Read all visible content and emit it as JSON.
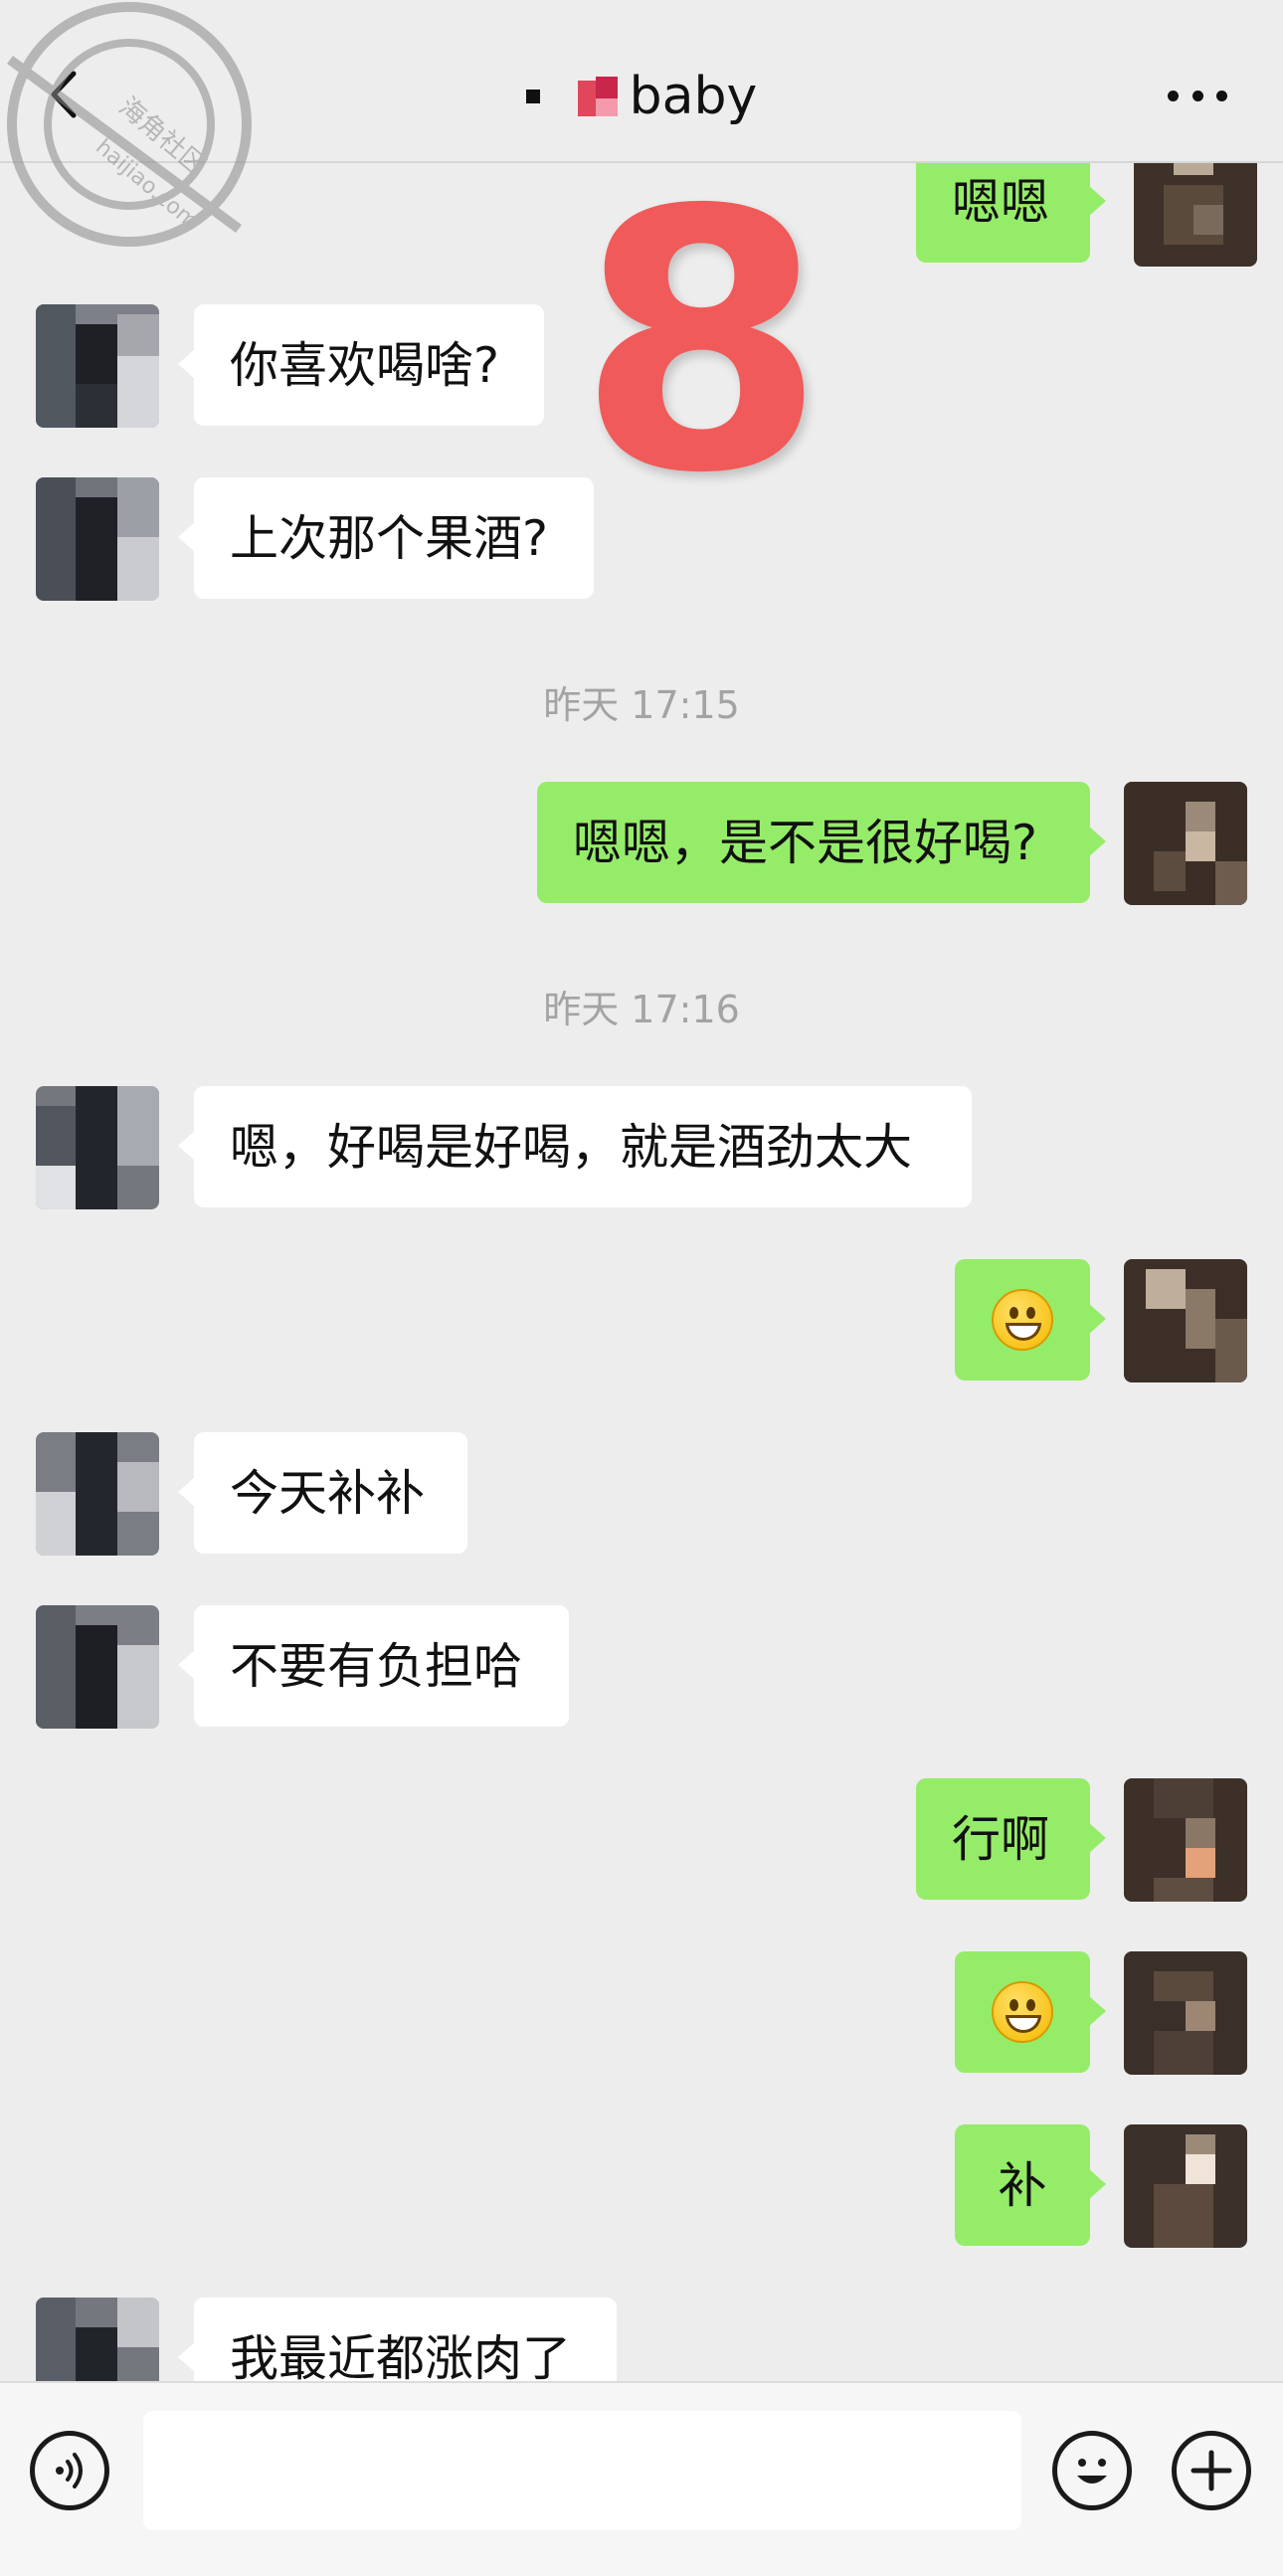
{
  "header": {
    "title": "baby",
    "back_icon": "chevron-left-icon",
    "more_icon": "ellipsis-icon"
  },
  "overlay": {
    "number": "8"
  },
  "watermark": {
    "line1": "海角社区",
    "line2": "haijiao.com"
  },
  "messages": [
    {
      "side": "out",
      "text": "嗯嗯"
    },
    {
      "side": "in",
      "text": "你喜欢喝啥?"
    },
    {
      "side": "in",
      "text": "上次那个果酒?"
    },
    {
      "type": "time",
      "text": "昨天 17:15"
    },
    {
      "side": "out",
      "text": "嗯嗯，是不是很好喝?"
    },
    {
      "type": "time",
      "text": "昨天 17:16"
    },
    {
      "side": "in",
      "text": "嗯，好喝是好喝，就是酒劲太大"
    },
    {
      "side": "out",
      "emoji": "grinning-face"
    },
    {
      "side": "in",
      "text": "今天补补"
    },
    {
      "side": "in",
      "text": "不要有负担哈"
    },
    {
      "side": "out",
      "text": "行啊"
    },
    {
      "side": "out",
      "emoji": "grinning-face"
    },
    {
      "side": "out",
      "text": "补"
    },
    {
      "side": "in",
      "text": "我最近都涨肉了"
    }
  ],
  "input_bar": {
    "voice_icon": "voice-icon",
    "emoji_icon": "smiley-icon",
    "plus_icon": "plus-icon",
    "input_value": ""
  },
  "colors": {
    "background": "#ededed",
    "outgoing_bubble": "#95ec69",
    "incoming_bubble": "#ffffff",
    "overlay_number": "#f05a5a"
  }
}
